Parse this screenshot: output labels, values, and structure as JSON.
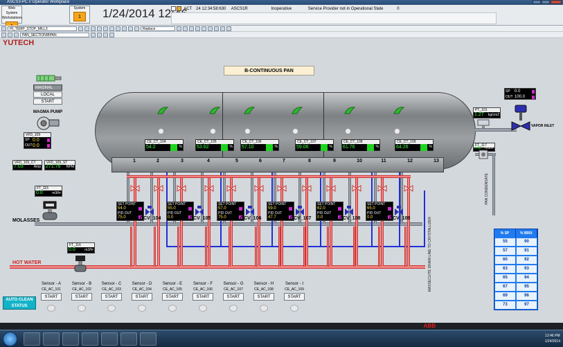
{
  "window": {
    "title": "ASCS3-PC // Operator Workplace"
  },
  "header": {
    "web_system": {
      "label": "Web System Workstations",
      "value": "1"
    },
    "system": {
      "label": "System",
      "value": "1"
    },
    "clock": "1/24/2014 12:46",
    "alarm": {
      "state": "ACT",
      "timestamp": "24 12:34:58:630",
      "source": "ASCS1R",
      "status": "Inoperative",
      "message": "Service Provider not in Operational State",
      "count": "0"
    }
  },
  "toolbar": {
    "object_select": "HI_TEMP_STOP_MILL3",
    "mode_select": "Replace",
    "section_select": "PAN_SECTION\\BPAN"
  },
  "graphic": {
    "brand": "YUTECH",
    "banner": "B-CONTINUOUS PAN",
    "magnal": "MAGNAL",
    "local_btn": "LOCAL",
    "start_btn": "START",
    "magma_pump": "MAGMA PUMP",
    "vfd": {
      "tag": "VFD_109",
      "sp_label": "SP",
      "sp": "0.0",
      "out_label": "OUT",
      "out": "0.0"
    },
    "vfd_ct": {
      "tag": "VFD_109_CT",
      "value": "7.03",
      "unit": "Amp"
    },
    "vfd_st": {
      "tag": "VFD_109_ST",
      "value": "271.76",
      "unit": "RPM"
    },
    "ft_115": {
      "tag": "FT_115",
      "value": "0.0",
      "unit": "m3/hr"
    },
    "ft_116": {
      "tag": "FT_116",
      "value": "0.0",
      "unit": "m3/hr"
    },
    "molasses": "MOLASSES",
    "hot_water": "HOT WATER",
    "pan_condensate": "PAN CONDENSATE",
    "massecuite_drain": "MASSECUITE DRAIN LINE TO CRYSTALLIZER",
    "vapor_inlet": "VAPOR INLET",
    "vapor_ctl": {
      "sp_label": "SP",
      "sp": "0.0",
      "out_label": "OUT",
      "out": "100.0"
    },
    "pt_101": {
      "tag": "PT_101",
      "value": "1.27",
      "unit": "kg/cm2"
    },
    "ft_117": {
      "tag": "FT_117",
      "value": "0.00",
      "unit": "m3/hr"
    },
    "cells": [
      "1",
      "2",
      "3",
      "4",
      "5",
      "6",
      "7",
      "8",
      "9",
      "10",
      "11",
      "12",
      "13"
    ],
    "temps": [
      {
        "tag": "CE_CT_104",
        "value": "54.2",
        "unit": "%"
      },
      {
        "tag": "CE_CT_105",
        "value": "53.62",
        "unit": "%"
      },
      {
        "tag": "CE_CT_106",
        "value": "57.10",
        "unit": "%"
      },
      {
        "tag": "CE_CT_107",
        "value": "59.06",
        "unit": "%"
      },
      {
        "tag": "CE_CT_108",
        "value": "61.76",
        "unit": "%"
      },
      {
        "tag": "CE_CT_109",
        "value": "64.26",
        "unit": "%"
      }
    ],
    "controllers": [
      {
        "sp_label": "SET POINT",
        "sp": "54.0",
        "out_label": "PID OUT",
        "out": "75.0",
        "valve": "CCV_104"
      },
      {
        "sp_label": "SET POINT",
        "sp": "55.0",
        "out_label": "PID OUT",
        "out": "0.0",
        "valve": "CCV_105"
      },
      {
        "sp_label": "SET POINT",
        "sp": "57.0",
        "out_label": "PID OUT",
        "out": "75.0",
        "valve": "CCV_106"
      },
      {
        "sp_label": "SET POINT",
        "sp": "59.0",
        "out_label": "PID OUT",
        "out": "47.7",
        "valve": "CCV_107"
      },
      {
        "sp_label": "SET POINT",
        "sp": "62.0",
        "out_label": "PID OUT",
        "out": "0.0",
        "valve": "CCV_108"
      },
      {
        "sp_label": "SET POINT",
        "sp": "65.0",
        "out_label": "PID OUT",
        "out": "0.0",
        "valve": "CCV_109"
      }
    ],
    "auto_clean": "AUTO CLEAN STATUS",
    "sensors": [
      {
        "name": "Sensor - A",
        "tag": "CE_AC_101",
        "btn": "START"
      },
      {
        "name": "Sensor - B",
        "tag": "CE_AC_102",
        "btn": "START"
      },
      {
        "name": "Sensor - C",
        "tag": "CE_AC_103",
        "btn": "START"
      },
      {
        "name": "Sensor - D",
        "tag": "CE_AC_104",
        "btn": "START"
      },
      {
        "name": "Sensor - E",
        "tag": "CE_AC_105",
        "btn": "START"
      },
      {
        "name": "Sensor - F",
        "tag": "CE_AC_106",
        "btn": "START"
      },
      {
        "name": "Sensor - G",
        "tag": "CE_AC_107",
        "btn": "START"
      },
      {
        "name": "Sensor - H",
        "tag": "CE_AC_108",
        "btn": "START"
      },
      {
        "name": "Sensor - I",
        "tag": "CE_AC_109",
        "btn": "START"
      }
    ],
    "sp_table": {
      "headers": [
        "% SP",
        "% BRIX"
      ],
      "rows": [
        [
          "55",
          "90"
        ],
        [
          "57",
          "91"
        ],
        [
          "60",
          "92"
        ],
        [
          "63",
          "93"
        ],
        [
          "65",
          "94"
        ],
        [
          "67",
          "95"
        ],
        [
          "69",
          "96"
        ],
        [
          "73",
          "97"
        ]
      ]
    }
  },
  "status_bar": {
    "brand": "ABB"
  },
  "taskbar": {
    "time": "12:46 PM",
    "date": "1/24/2014"
  },
  "colors": {
    "accent_orange": "#f6a51c",
    "value_green": "#40ff40",
    "hot_water": "#f08585",
    "drain_blue": "#1f2fd6",
    "table_blue": "#1f7bef",
    "auto_clean": "#12b3c8"
  }
}
